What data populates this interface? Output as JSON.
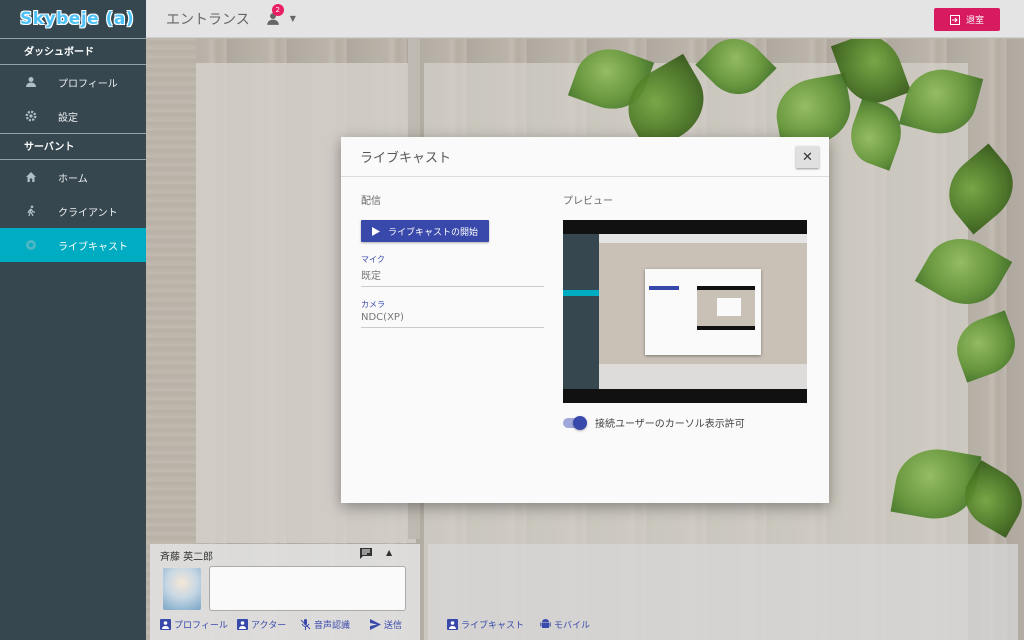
{
  "app": {
    "logo": "Skybeje (a)"
  },
  "sidebar": {
    "sections": [
      {
        "title": "ダッシュボード",
        "items": [
          {
            "label": "プロフィール",
            "icon": "person-icon"
          },
          {
            "label": "設定",
            "icon": "gear-icon"
          }
        ]
      },
      {
        "title": "サーバント",
        "items": [
          {
            "label": "ホーム",
            "icon": "home-icon"
          },
          {
            "label": "クライアント",
            "icon": "walk-icon"
          },
          {
            "label": "ライブキャスト",
            "icon": "broadcast-icon",
            "active": true
          }
        ]
      }
    ]
  },
  "header": {
    "room_name": "エントランス",
    "user_count": "2",
    "leave_label": "退室"
  },
  "modal": {
    "title": "ライブキャスト",
    "close": "✕",
    "broadcast": {
      "title": "配信",
      "start_label": "ライブキャストの開始",
      "mic_label": "マイク",
      "mic_value": "既定",
      "camera_label": "カメラ",
      "camera_value": "NDC(XP)"
    },
    "preview": {
      "title": "プレビュー",
      "cursor_toggle_label": "接続ユーザーのカーソル表示許可",
      "cursor_toggle_on": true
    }
  },
  "user_panel": {
    "name": "斉藤 英二郎",
    "actions": {
      "profile": "プロフィール",
      "actor": "アクター",
      "voice": "音声認識",
      "send": "送信"
    }
  },
  "stream_panel": {
    "actions": {
      "livecast": "ライブキャスト",
      "mobile": "モバイル"
    }
  },
  "colors": {
    "sidebar": "#37474f",
    "active": "#00acc1",
    "primary": "#3949ab",
    "leave": "#d81b60"
  }
}
